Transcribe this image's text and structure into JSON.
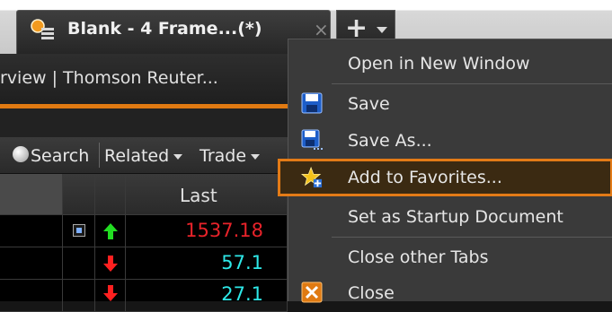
{
  "tab": {
    "title": "Blank - 4 Frame...(*)",
    "close_glyph": "×",
    "new_tab_glyph": "+"
  },
  "subtab": {
    "title": "rview | Thomson Reuter..."
  },
  "toolbar": {
    "search_label": "Search",
    "related_label": "Related",
    "trade_label": "Trade"
  },
  "grid": {
    "column_header": "Last",
    "rows": [
      {
        "value": "1537.18",
        "color": "#e8232a",
        "arrow": "up",
        "arrow_color": "#22dd22",
        "has_icon": true
      },
      {
        "value": "57.1",
        "color": "#2ee8e8",
        "arrow": "down",
        "arrow_color": "#ff2020",
        "has_icon": false
      },
      {
        "value": "27.1",
        "color": "#2ee8e8",
        "arrow": "down",
        "arrow_color": "#ff2020",
        "has_icon": false
      }
    ]
  },
  "menu": {
    "accent_color": "#e37b17",
    "items": {
      "open_new_window": "Open in New Window",
      "save": "Save",
      "save_as": "Save As...",
      "add_favorites": "Add to Favorites...",
      "set_startup": "Set as Startup Document",
      "close_other_tabs": "Close other Tabs",
      "close": "Close"
    },
    "icons": {
      "save": "save-disk-icon",
      "save_as": "save-as-disk-icon",
      "add_favorites": "star-add-icon",
      "close": "close-x-icon"
    }
  }
}
